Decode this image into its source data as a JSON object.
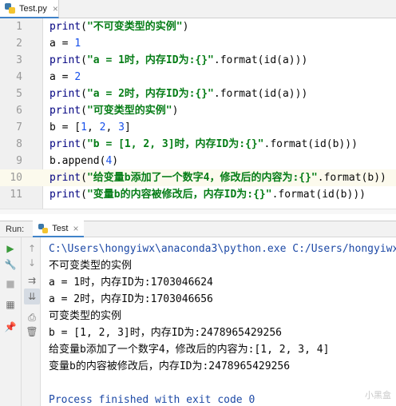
{
  "editor_tab": {
    "filename": "Test.py",
    "close": "×"
  },
  "code_lines": [
    {
      "n": "1",
      "parts": [
        [
          "fn",
          "print"
        ],
        [
          "p",
          "("
        ],
        [
          "str",
          "\"不可变类型的实例\""
        ],
        [
          "p",
          ")"
        ]
      ]
    },
    {
      "n": "2",
      "parts": [
        [
          "p",
          "a = "
        ],
        [
          "num",
          "1"
        ]
      ]
    },
    {
      "n": "3",
      "parts": [
        [
          "fn",
          "print"
        ],
        [
          "p",
          "("
        ],
        [
          "str",
          "\"a = 1时，内存ID为:{}\""
        ],
        [
          "p",
          ".format(id(a)))"
        ]
      ]
    },
    {
      "n": "4",
      "parts": [
        [
          "p",
          "a = "
        ],
        [
          "num",
          "2"
        ]
      ]
    },
    {
      "n": "5",
      "parts": [
        [
          "fn",
          "print"
        ],
        [
          "p",
          "("
        ],
        [
          "str",
          "\"a = 2时，内存ID为:{}\""
        ],
        [
          "p",
          ".format(id(a)))"
        ]
      ]
    },
    {
      "n": "6",
      "parts": [
        [
          "fn",
          "print"
        ],
        [
          "p",
          "("
        ],
        [
          "str",
          "\"可变类型的实例\""
        ],
        [
          "p",
          ")"
        ]
      ]
    },
    {
      "n": "7",
      "parts": [
        [
          "p",
          "b = ["
        ],
        [
          "num",
          "1"
        ],
        [
          "p",
          ", "
        ],
        [
          "num",
          "2"
        ],
        [
          "p",
          ", "
        ],
        [
          "num",
          "3"
        ],
        [
          "p",
          "]"
        ]
      ]
    },
    {
      "n": "8",
      "parts": [
        [
          "fn",
          "print"
        ],
        [
          "p",
          "("
        ],
        [
          "str",
          "\"b = [1, 2, 3]时，内存ID为:{}\""
        ],
        [
          "p",
          ".format(id(b)))"
        ]
      ]
    },
    {
      "n": "9",
      "parts": [
        [
          "p",
          "b.append("
        ],
        [
          "num",
          "4"
        ],
        [
          "p",
          ")"
        ]
      ]
    },
    {
      "n": "10",
      "parts": [
        [
          "fn",
          "print"
        ],
        [
          "p",
          "("
        ],
        [
          "str",
          "\"给变量b添加了一个数字4，修改后的内容为:{}\""
        ],
        [
          "p",
          ".format(b))"
        ]
      ]
    },
    {
      "n": "11",
      "parts": [
        [
          "fn",
          "print"
        ],
        [
          "p",
          "("
        ],
        [
          "str",
          "\"变量b的内容被修改后，内存ID为:{}\""
        ],
        [
          "p",
          ".format(id(b)))"
        ]
      ]
    }
  ],
  "current_line_index": 9,
  "run_window": {
    "label": "Run:",
    "tab_name": "Test",
    "close": "×"
  },
  "console_lines": [
    {
      "kind": "cmd",
      "text": "C:\\Users\\hongyiwx\\anaconda3\\python.exe C:/Users/hongyiwx"
    },
    {
      "kind": "out",
      "text": "不可变类型的实例"
    },
    {
      "kind": "out",
      "text": "a = 1时，内存ID为:1703046624"
    },
    {
      "kind": "out",
      "text": "a = 2时，内存ID为:1703046656"
    },
    {
      "kind": "out",
      "text": "可变类型的实例"
    },
    {
      "kind": "out",
      "text": "b = [1, 2, 3]时，内存ID为:2478965429256"
    },
    {
      "kind": "out",
      "text": "给变量b添加了一个数字4，修改后的内容为:[1, 2, 3, 4]"
    },
    {
      "kind": "out",
      "text": "变量b的内容被修改后，内存ID为:2478965429256"
    },
    {
      "kind": "blank",
      "text": ""
    },
    {
      "kind": "exit",
      "text": "Process finished with exit code 0"
    }
  ],
  "toolbar_left": [
    {
      "name": "rerun-icon",
      "glyph": "▶",
      "color": "#3a9a3a"
    },
    {
      "name": "wrench-icon",
      "glyph": "🔧",
      "color": "#6e6e6e"
    },
    {
      "name": "stop-icon",
      "glyph": "■",
      "color": "#b0b0b0"
    },
    {
      "name": "layout-icon",
      "glyph": "▦",
      "color": "#6e6e6e"
    },
    {
      "name": "pin-icon",
      "glyph": "📌",
      "color": "#6e6e6e"
    }
  ],
  "toolbar_right": [
    {
      "name": "up-icon",
      "glyph": "↑",
      "color": "#9a9a9a"
    },
    {
      "name": "down-icon",
      "glyph": "↓",
      "color": "#9a9a9a"
    },
    {
      "name": "soft-wrap-icon",
      "glyph": "⇉",
      "color": "#6e6e6e"
    },
    {
      "name": "scroll-end-icon",
      "glyph": "⇊",
      "color": "#6e6e6e"
    },
    {
      "name": "print-icon",
      "glyph": "⎙",
      "color": "#6e6e6e"
    },
    {
      "name": "trash-icon",
      "glyph": "🗑",
      "color": "#6e6e6e"
    }
  ],
  "watermark": "小黑盒"
}
